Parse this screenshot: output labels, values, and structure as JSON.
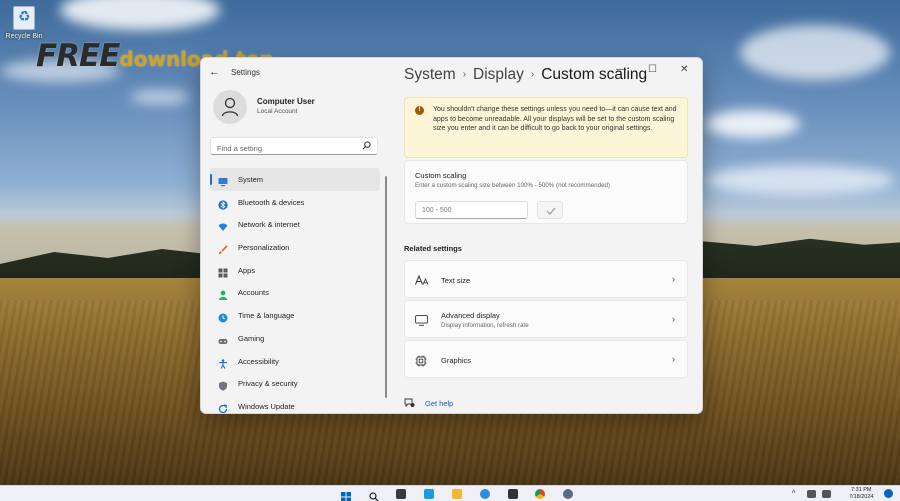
{
  "desktop": {
    "recycle_bin_label": "Recycle Bin",
    "watermark_part1": "FREE",
    "watermark_part2": "download.top"
  },
  "window": {
    "app_title": "Settings",
    "back_symbol": "←",
    "controls": {
      "minimize": "—",
      "maximize": "☐",
      "close": "✕"
    }
  },
  "profile": {
    "name": "Computer User",
    "account_type": "Local Account"
  },
  "search": {
    "placeholder": "Find a setting"
  },
  "nav": {
    "items": [
      {
        "label": "System",
        "icon": "monitor-icon",
        "color": "#2f7bd0",
        "active": true
      },
      {
        "label": "Bluetooth & devices",
        "icon": "bluetooth-icon",
        "color": "#1a73c9",
        "active": false
      },
      {
        "label": "Network & internet",
        "icon": "wifi-icon",
        "color": "#2383d8",
        "active": false
      },
      {
        "label": "Personalization",
        "icon": "brush-icon",
        "color": "#d86a2a",
        "active": false
      },
      {
        "label": "Apps",
        "icon": "apps-icon",
        "color": "#555b66",
        "active": false
      },
      {
        "label": "Accounts",
        "icon": "person-icon",
        "color": "#2bb069",
        "active": false
      },
      {
        "label": "Time & language",
        "icon": "globe-clock-icon",
        "color": "#1e8fd6",
        "active": false
      },
      {
        "label": "Gaming",
        "icon": "gamepad-icon",
        "color": "#6a6f78",
        "active": false
      },
      {
        "label": "Accessibility",
        "icon": "accessibility-icon",
        "color": "#1a73c9",
        "active": false
      },
      {
        "label": "Privacy & security",
        "icon": "shield-icon",
        "color": "#70767f",
        "active": false
      },
      {
        "label": "Windows Update",
        "icon": "update-icon",
        "color": "#1a73c9",
        "active": false
      }
    ]
  },
  "breadcrumb": {
    "items": [
      "System",
      "Display",
      "Custom scaling"
    ],
    "separator": "›"
  },
  "warning": {
    "icon": "info-icon",
    "text": "You shouldn't change these settings unless you need to—it can cause text and apps to become unreadable. All your displays will be set to the custom scaling size you enter and it can be difficult to go back to your original settings."
  },
  "custom_scaling": {
    "title": "Custom scaling",
    "subtitle": "Enter a custom scaling size between 100% - 500% (not recommended)",
    "input_placeholder": "100 - 500",
    "apply_icon": "check-icon"
  },
  "related": {
    "heading": "Related settings",
    "items": [
      {
        "title": "Text size",
        "subtitle": "",
        "icon": "text-size-icon"
      },
      {
        "title": "Advanced display",
        "subtitle": "Display information, refresh rate",
        "icon": "monitor-icon"
      },
      {
        "title": "Graphics",
        "subtitle": "",
        "icon": "graphics-chip-icon"
      }
    ],
    "chevron": "›"
  },
  "help": {
    "label": "Get help"
  },
  "taskbar": {
    "time": "7:31 PM",
    "date": "7/18/2024",
    "accent": "#0067c0"
  }
}
